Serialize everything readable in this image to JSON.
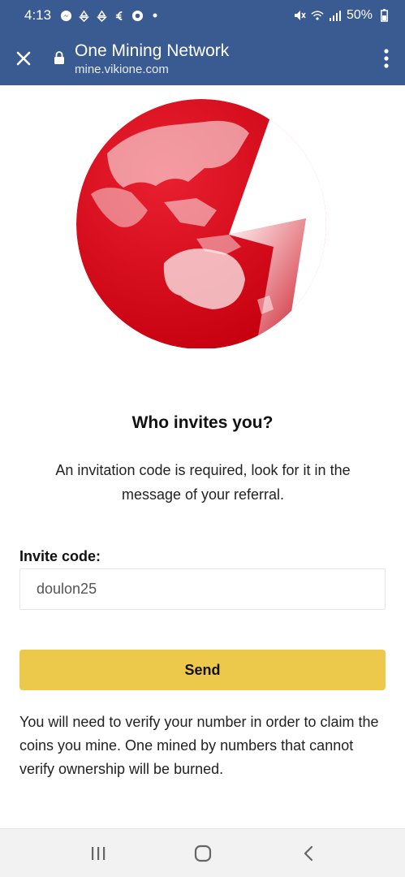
{
  "status_bar": {
    "time": "4:13",
    "battery": "50%",
    "icons_left": [
      "messenger-icon",
      "recycle-icon",
      "recycle-icon",
      "currency-icon",
      "chrome-icon",
      "dot-icon"
    ],
    "icons_right": [
      "mute-icon",
      "wifi-icon",
      "signal-icon",
      "battery-icon"
    ]
  },
  "browser": {
    "title": "One Mining Network",
    "url": "mine.vikione.com",
    "color": "#3a5a92"
  },
  "page": {
    "heading": "Who invites you?",
    "description": "An invitation code is required, look for it in the message of your referral.",
    "invite_label": "Invite code:",
    "invite_value": "doulon25",
    "send_label": "Send",
    "notice": "You will need to verify your number in order to claim the coins you mine. One mined by numbers that cannot verify ownership will be burned.",
    "accent_color": "#ecc94b",
    "logo_color": "#d90012"
  },
  "nav": {
    "buttons": [
      "recents-icon",
      "home-icon",
      "back-icon"
    ]
  }
}
